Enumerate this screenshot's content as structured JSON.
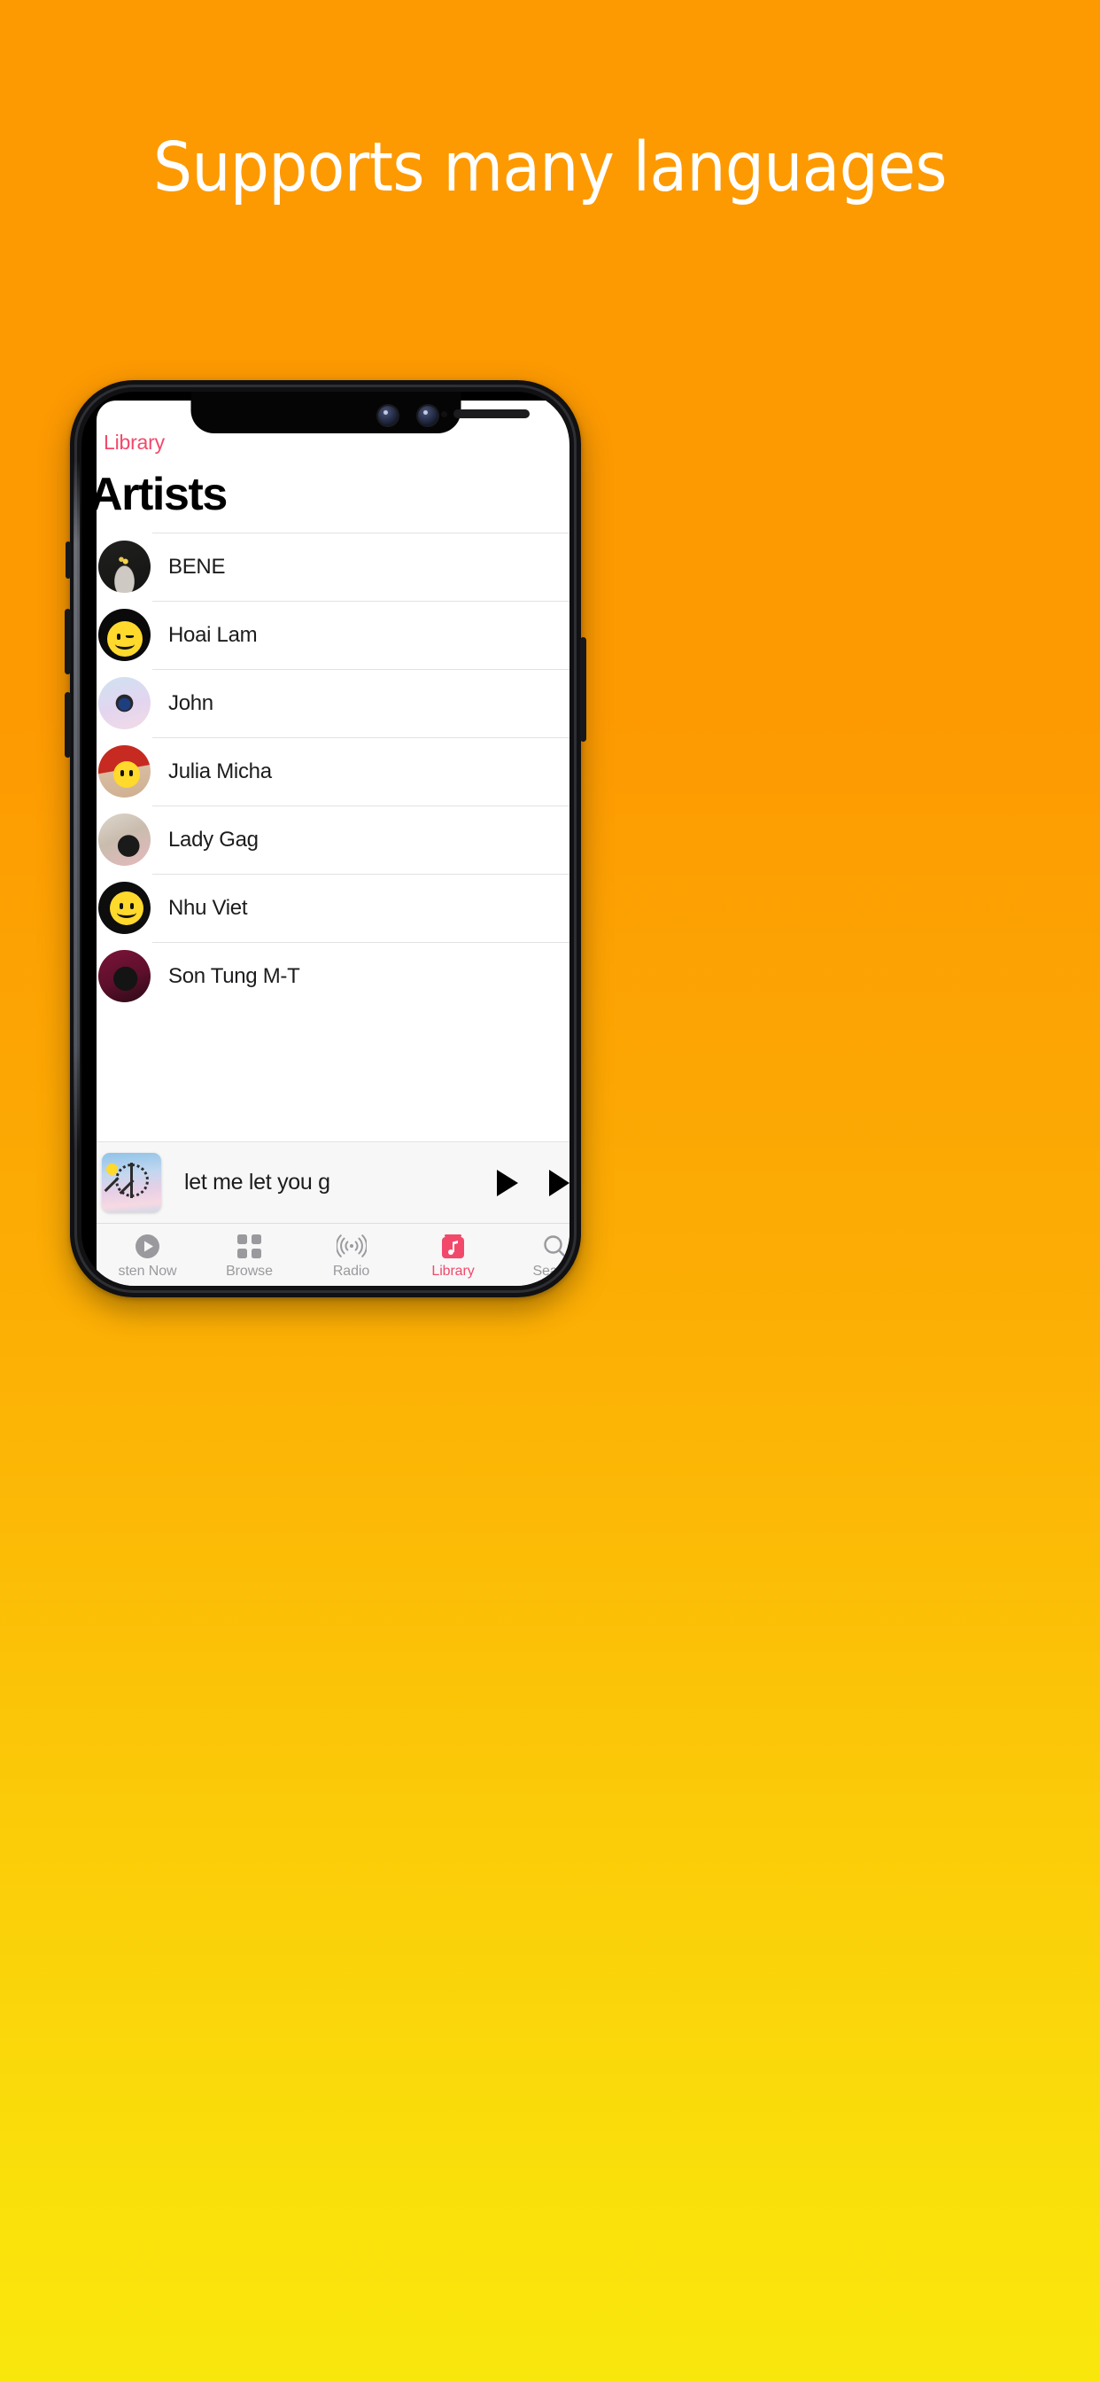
{
  "promo": {
    "headline": "Supports many languages",
    "background_top_color": "#FD9A02",
    "background_bottom_color": "#F9E70C",
    "headline_color": "#FFFFFF"
  },
  "app": {
    "accent_color": "#F2496B",
    "nav": {
      "back_label": "Library",
      "back_icon": "chevron-left-icon",
      "page_title": "Artists"
    },
    "artists": [
      {
        "name": "BENE",
        "avatar": "av-bene",
        "avatar_desc": "bene-portrait-artwork"
      },
      {
        "name": "Hoai Lam",
        "avatar": "av-hoai",
        "avatar_desc": "winking-smiley-artwork"
      },
      {
        "name": "John",
        "avatar": "av-john",
        "avatar_desc": "john-pastel-artwork"
      },
      {
        "name": "Julia Micha",
        "avatar": "av-julia",
        "avatar_desc": "julia-red-smiley-artwork"
      },
      {
        "name": "Lady Gag",
        "avatar": "av-lady",
        "avatar_desc": "lady-gaga-artwork"
      },
      {
        "name": "Nhu Viet",
        "avatar": "av-nhu",
        "avatar_desc": "smiley-face-artwork"
      },
      {
        "name": "Son Tung M-T",
        "avatar": "av-son",
        "avatar_desc": "son-tung-magenta-artwork"
      }
    ],
    "miniplayer": {
      "track_title": "let me let you g",
      "artwork_desc": "peace-sign-pastel-sky-artwork",
      "play_icon": "play-icon",
      "next_icon": "fast-forward-icon"
    },
    "tabbar": {
      "active_index": 3,
      "items": [
        {
          "label": "sten Now",
          "icon": "play-circle-icon"
        },
        {
          "label": "Browse",
          "icon": "grid-icon"
        },
        {
          "label": "Radio",
          "icon": "broadcast-icon"
        },
        {
          "label": "Library",
          "icon": "library-music-icon"
        },
        {
          "label": "Search",
          "icon": "search-icon"
        }
      ]
    }
  }
}
